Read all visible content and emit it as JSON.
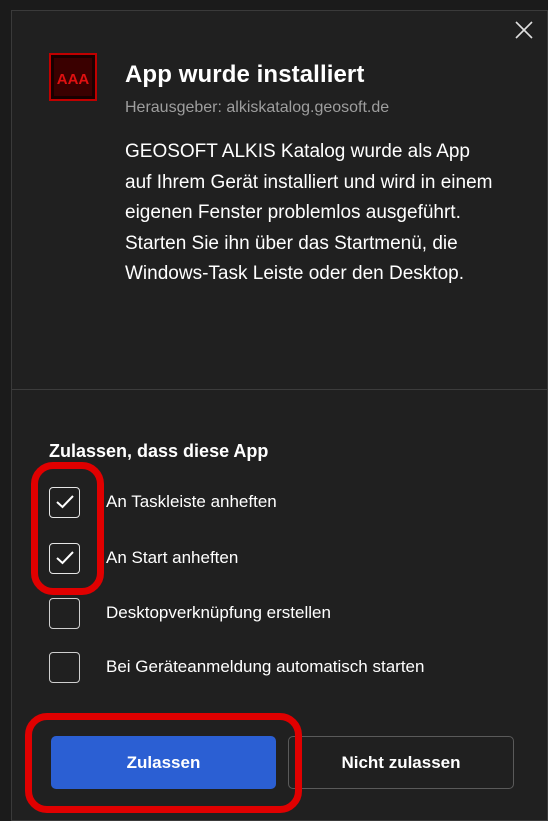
{
  "dialog": {
    "close_icon": "close-icon",
    "app_icon_text": "AAA",
    "title": "App wurde installiert",
    "publisher": "Herausgeber: alkiskatalog.geosoft.de",
    "description": "GEOSOFT ALKIS Katalog wurde als App auf Ihrem Gerät installiert und wird in einem eigenen Fenster problemlos ausgeführt. Starten Sie ihn über das Startmenü, die Windows-Task Leiste oder den Desktop."
  },
  "permissions": {
    "heading": "Zulassen, dass diese App",
    "options": [
      {
        "label": "An Taskleiste anheften",
        "checked": true
      },
      {
        "label": "An Start anheften",
        "checked": true
      },
      {
        "label": "Desktopverknüpfung erstellen",
        "checked": false
      },
      {
        "label": "Bei Geräteanmeldung automatisch starten",
        "checked": false
      }
    ]
  },
  "buttons": {
    "allow": "Zulassen",
    "deny": "Nicht zulassen"
  },
  "colors": {
    "background": "#202020",
    "primary_button": "#2b5fd3",
    "app_icon_red": "#c00000",
    "annotation_red": "#e00000"
  }
}
